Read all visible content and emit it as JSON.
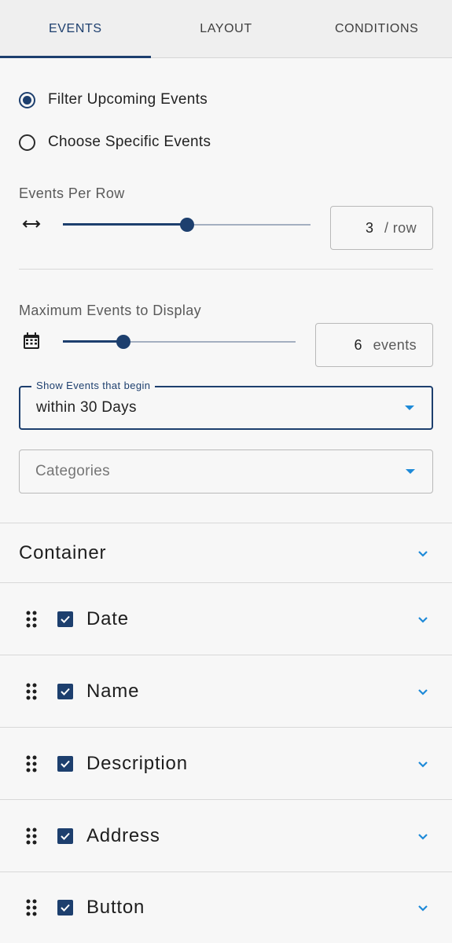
{
  "tabs": [
    {
      "label": "EVENTS",
      "active": true
    },
    {
      "label": "LAYOUT",
      "active": false
    },
    {
      "label": "CONDITIONS",
      "active": false
    }
  ],
  "source": {
    "options": [
      {
        "label": "Filter Upcoming Events",
        "checked": true
      },
      {
        "label": "Choose Specific Events",
        "checked": false
      }
    ]
  },
  "per_row": {
    "label": "Events Per Row",
    "icon": "arrows-horizontal-icon",
    "value": "3",
    "unit": "/ row",
    "slider_fraction": 0.5
  },
  "max_events": {
    "label": "Maximum Events to Display",
    "icon": "calendar-icon",
    "value": "6",
    "unit": "events",
    "slider_fraction": 0.26
  },
  "begin_select": {
    "legend": "Show Events that begin",
    "value": "within 30 Days"
  },
  "categories_select": {
    "placeholder": "Categories"
  },
  "container": {
    "title": "Container"
  },
  "elements": [
    {
      "label": "Date",
      "checked": true
    },
    {
      "label": "Name",
      "checked": true
    },
    {
      "label": "Description",
      "checked": true
    },
    {
      "label": "Address",
      "checked": true
    },
    {
      "label": "Button",
      "checked": true
    }
  ],
  "colors": {
    "accent": "#1d3f6e",
    "chevron": "#1e8ad8",
    "background": "#f7f7f7"
  }
}
